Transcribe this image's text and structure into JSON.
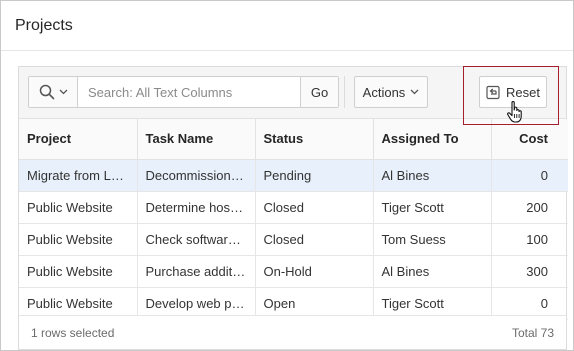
{
  "region": {
    "title": "Projects"
  },
  "toolbar": {
    "search_placeholder": "Search: All Text Columns",
    "go_label": "Go",
    "actions_label": "Actions",
    "reset_label": "Reset"
  },
  "table": {
    "columns": [
      "Project",
      "Task Name",
      "Status",
      "Assigned To",
      "Cost"
    ],
    "rows": [
      [
        "Migrate from Le...",
        "Decommission L...",
        "Pending",
        "Al Bines",
        "0"
      ],
      [
        "Public Website",
        "Determine host s...",
        "Closed",
        "Tiger Scott",
        "200"
      ],
      [
        "Public Website",
        "Check software li...",
        "Closed",
        "Tom Suess",
        "100"
      ],
      [
        "Public Website",
        "Purchase additio...",
        "On-Hold",
        "Al Bines",
        "300"
      ],
      [
        "Public Website",
        "Develop web pa...",
        "Open",
        "Tiger Scott",
        "0"
      ]
    ]
  },
  "footer": {
    "selection_text": "1 rows selected",
    "total_text": "Total 73"
  },
  "icons": {
    "search": "magnifier-icon",
    "chevron": "chevron-down-icon",
    "reset": "reset-icon",
    "cursor": "hand-pointer-icon"
  }
}
